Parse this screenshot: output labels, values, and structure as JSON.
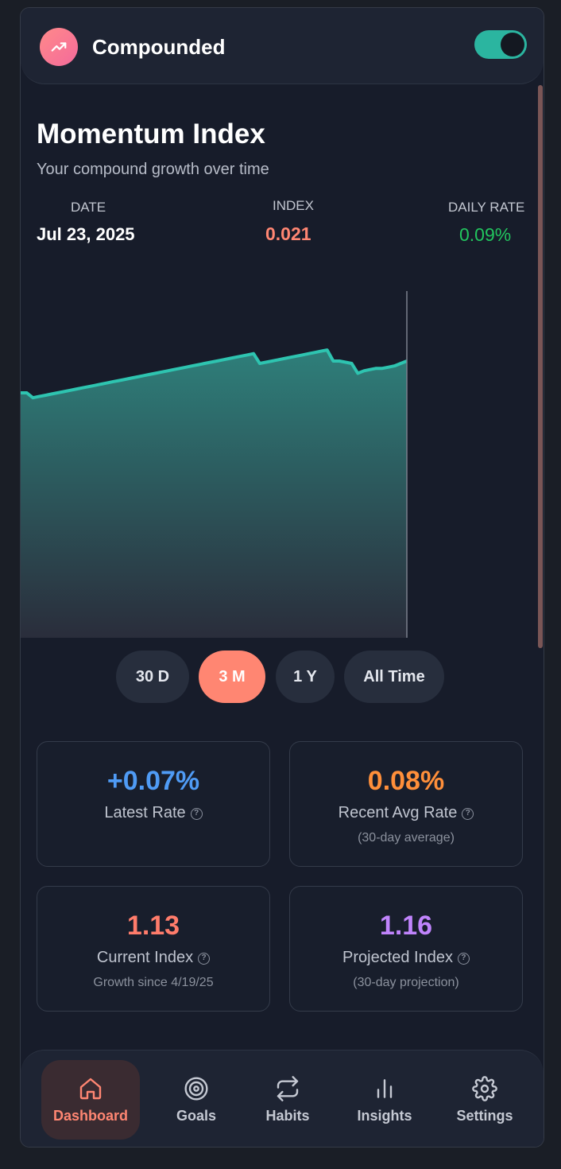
{
  "header": {
    "app_title": "Compounded",
    "logo_icon": "trending-up-icon",
    "toggle_on": true
  },
  "main": {
    "title": "Momentum Index",
    "subtitle": "Your compound growth over time",
    "stats": {
      "date_label": "DATE",
      "date_value": "Jul 23, 2025",
      "index_label": "INDEX",
      "index_value": "0.021",
      "rate_label": "DAILY RATE",
      "rate_value": "0.09%"
    }
  },
  "chart_data": {
    "type": "area",
    "title": "",
    "xlabel": "",
    "ylabel": "",
    "y": [
      1.0,
      1.0,
      0.98,
      0.985,
      0.99,
      0.995,
      1.0,
      1.005,
      1.01,
      1.015,
      1.02,
      1.025,
      1.03,
      1.035,
      1.04,
      1.045,
      1.05,
      1.055,
      1.06,
      1.065,
      1.07,
      1.075,
      1.08,
      1.085,
      1.09,
      1.095,
      1.1,
      1.105,
      1.11,
      1.115,
      1.12,
      1.125,
      1.13,
      1.135,
      1.14,
      1.145,
      1.15,
      1.155,
      1.16,
      1.12,
      1.125,
      1.13,
      1.135,
      1.14,
      1.145,
      1.15,
      1.155,
      1.16,
      1.165,
      1.17,
      1.175,
      1.13,
      1.13,
      1.125,
      1.12,
      1.08,
      1.09,
      1.095,
      1.1,
      1.1,
      1.105,
      1.11,
      1.12,
      1.13
    ],
    "ylim": [
      0,
      1.5
    ],
    "line_color": "#2ec4b0",
    "fill_top_color": "#2e7f7a",
    "fill_bottom_color": "#2a2d3b",
    "grid": false
  },
  "ranges": {
    "items": [
      "30 D",
      "3 M",
      "1 Y",
      "All Time"
    ],
    "selected": "3 M"
  },
  "cards": [
    {
      "value": "+0.07%",
      "label": "Latest Rate",
      "sub": "",
      "color": "#4f9bf5"
    },
    {
      "value": "0.08%",
      "label": "Recent Avg Rate",
      "sub": "(30-day average)",
      "color": "#ff8f3a"
    },
    {
      "value": "1.13",
      "label": "Current Index",
      "sub": "Growth since 4/19/25",
      "color": "#ff7c6b"
    },
    {
      "value": "1.16",
      "label": "Projected Index",
      "sub": "(30-day projection)",
      "color": "#c084fc"
    }
  ],
  "nav": {
    "items": [
      {
        "label": "Dashboard",
        "icon": "home-icon"
      },
      {
        "label": "Goals",
        "icon": "target-icon"
      },
      {
        "label": "Habits",
        "icon": "repeat-icon"
      },
      {
        "label": "Insights",
        "icon": "bar-chart-icon"
      },
      {
        "label": "Settings",
        "icon": "gear-icon"
      }
    ],
    "active": "Dashboard"
  },
  "colors": {
    "accent": "#ff8672",
    "index_value": "#ff8672",
    "daily_rate": "#22c55e",
    "toggle": "#2bb5a0"
  }
}
